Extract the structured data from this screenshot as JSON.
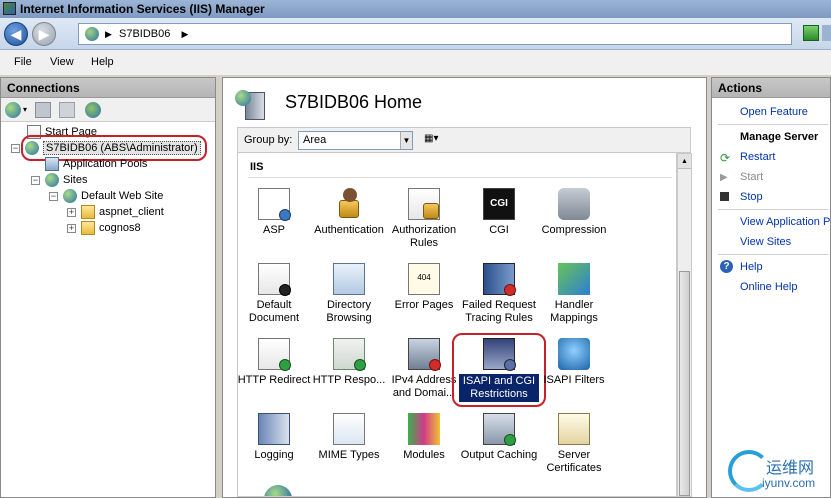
{
  "window": {
    "title": "Internet Information Services (IIS) Manager"
  },
  "address": {
    "path": "S7BIDB06"
  },
  "menu": [
    "File",
    "View",
    "Help"
  ],
  "connections": {
    "header": "Connections",
    "tree": {
      "start_page": "Start Page",
      "server": "S7BIDB06 (ABS\\Administrator)",
      "app_pools": "Application Pools",
      "sites": "Sites",
      "default_site": "Default Web Site",
      "child1": "aspnet_client",
      "child2": "cognos8"
    }
  },
  "main": {
    "title": "S7BIDB06 Home",
    "group_by_label": "Group by:",
    "group_by_value": "Area",
    "section": "IIS",
    "features": [
      {
        "label": "ASP",
        "icon": "asp-icon"
      },
      {
        "label": "Authentication",
        "icon": "authentication-icon"
      },
      {
        "label": "Authorization Rules",
        "icon": "authorization-rules-icon"
      },
      {
        "label": "CGI",
        "icon": "cgi-icon"
      },
      {
        "label": "Compression",
        "icon": "compression-icon"
      },
      {
        "label": "Default Document",
        "icon": "default-document-icon"
      },
      {
        "label": "Directory Browsing",
        "icon": "directory-browsing-icon"
      },
      {
        "label": "Error Pages",
        "icon": "error-pages-icon"
      },
      {
        "label": "Failed Request Tracing Rules",
        "icon": "failed-request-tracing-icon"
      },
      {
        "label": "Handler Mappings",
        "icon": "handler-mappings-icon"
      },
      {
        "label": "HTTP Redirect",
        "icon": "http-redirect-icon"
      },
      {
        "label": "HTTP Respo...",
        "icon": "http-response-headers-icon"
      },
      {
        "label": "IPv4 Address and Domai...",
        "icon": "ipv4-address-icon"
      },
      {
        "label": "ISAPI and CGI Restrictions",
        "icon": "isapi-cgi-restrictions-icon"
      },
      {
        "label": "ISAPI Filters",
        "icon": "isapi-filters-icon"
      },
      {
        "label": "Logging",
        "icon": "logging-icon"
      },
      {
        "label": "MIME Types",
        "icon": "mime-types-icon"
      },
      {
        "label": "Modules",
        "icon": "modules-icon"
      },
      {
        "label": "Output Caching",
        "icon": "output-caching-icon"
      },
      {
        "label": "Server Certificates",
        "icon": "server-certificates-icon"
      }
    ]
  },
  "actions": {
    "header": "Actions",
    "open_feature": "Open Feature",
    "manage_server": "Manage Server",
    "restart": "Restart",
    "start": "Start",
    "stop": "Stop",
    "view_app_pools": "View Application Pools",
    "view_sites": "View Sites",
    "help": "Help",
    "online_help": "Online Help"
  },
  "watermark": {
    "cn": "运维网",
    "url": "iyunv.com"
  },
  "colors": {
    "highlight_circle": "#c8202a",
    "selection": "#0a246a",
    "link": "#0033aa"
  }
}
